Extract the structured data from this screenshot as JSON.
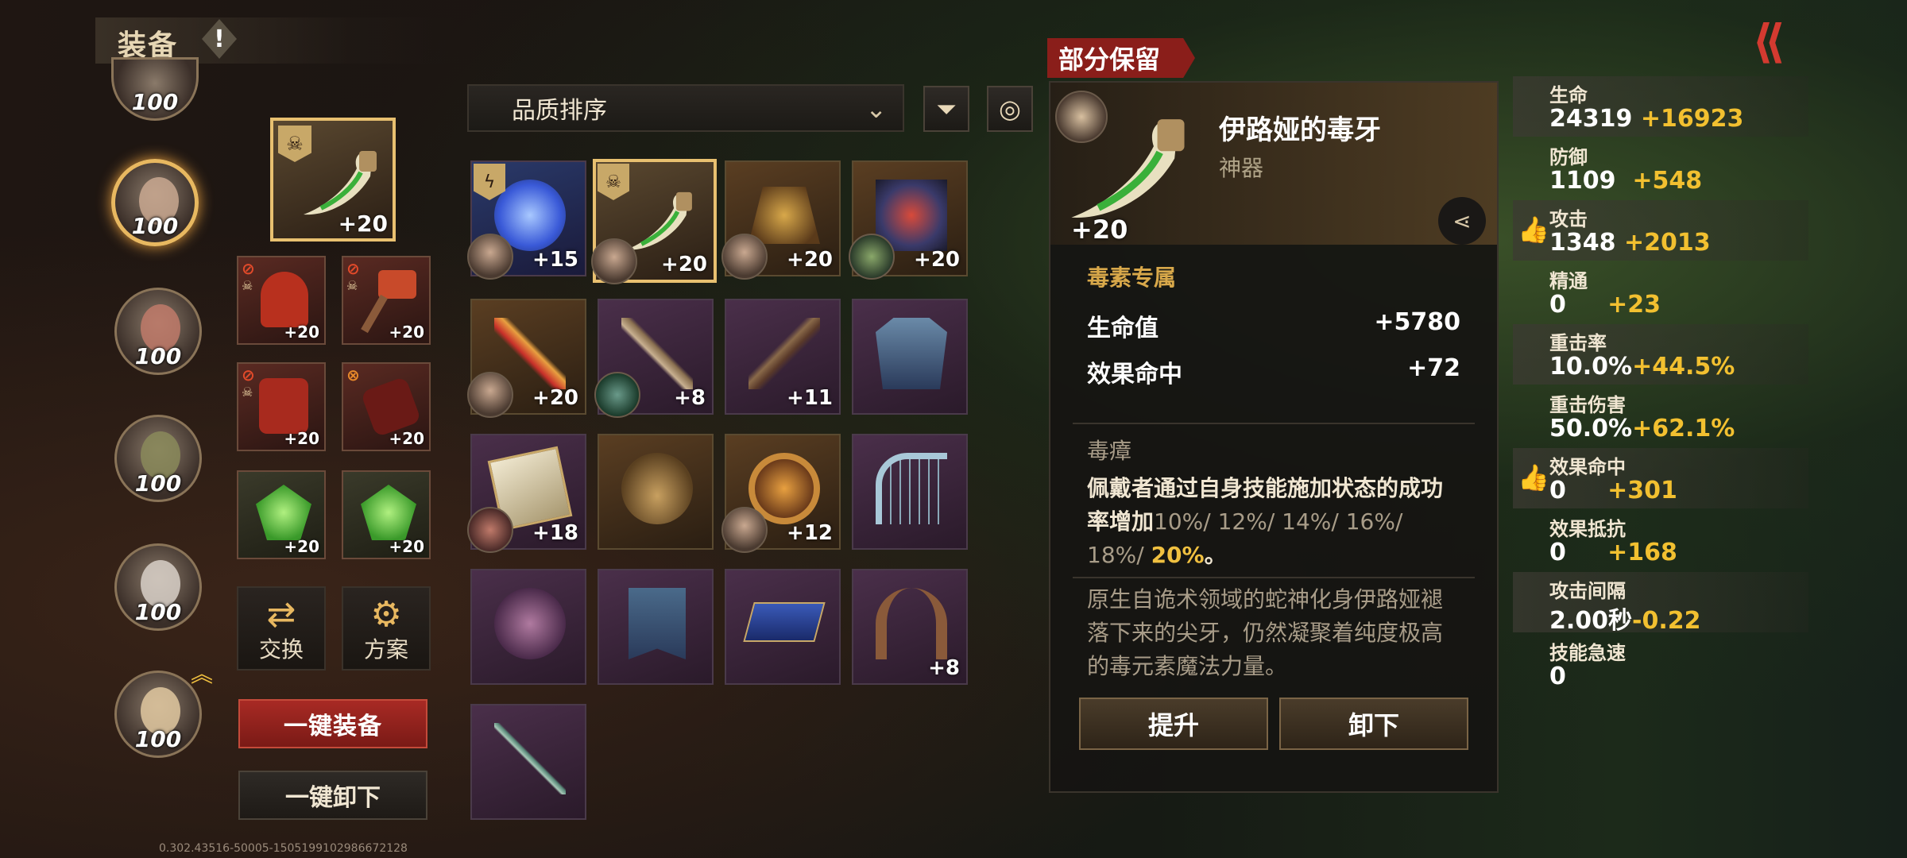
{
  "header": {
    "title": "装备",
    "info_icon": "!",
    "back_icon": "⟪"
  },
  "heroes": [
    {
      "level": "100"
    },
    {
      "level": "100",
      "selected": true
    },
    {
      "level": "100"
    },
    {
      "level": "100"
    },
    {
      "level": "100"
    },
    {
      "level": "100"
    }
  ],
  "equipped": {
    "main_plus": "+20",
    "gear": [
      "+20",
      "+20",
      "+20",
      "+20"
    ],
    "gems": [
      "+20",
      "+20"
    ]
  },
  "utility": {
    "swap_label": "交换",
    "plan_label": "方案"
  },
  "actions": {
    "equip_all": "一键装备",
    "unequip_all": "一键卸下"
  },
  "version": "0.302.43516-50005-1505199102986672128",
  "sort": {
    "label": "品质排序"
  },
  "inventory": [
    {
      "plus": "+15",
      "owner": true,
      "kind": "orb"
    },
    {
      "plus": "+20",
      "owner": true,
      "kind": "fang",
      "selected": true
    },
    {
      "plus": "+20",
      "owner": true,
      "kind": "gold"
    },
    {
      "plus": "+20",
      "owner": true,
      "kind": "gold"
    },
    {
      "plus": "+20",
      "owner": true,
      "kind": "gold"
    },
    {
      "plus": "+8",
      "owner": true,
      "kind": "purple"
    },
    {
      "plus": "+11",
      "owner": false,
      "kind": "purple"
    },
    {
      "plus": "",
      "owner": false,
      "kind": "purple"
    },
    {
      "plus": "+18",
      "owner": true,
      "kind": "purple"
    },
    {
      "plus": "",
      "owner": false,
      "kind": "gold"
    },
    {
      "plus": "+12",
      "owner": true,
      "kind": "gold"
    },
    {
      "plus": "",
      "owner": false,
      "kind": "purple"
    },
    {
      "plus": "",
      "owner": false,
      "kind": "purple"
    },
    {
      "plus": "",
      "owner": false,
      "kind": "purple"
    },
    {
      "plus": "",
      "owner": false,
      "kind": "purple"
    },
    {
      "plus": "+8",
      "owner": false,
      "kind": "purple"
    },
    {
      "plus": "",
      "owner": false,
      "kind": "purple"
    }
  ],
  "detail": {
    "tag": "部分保留",
    "name": "伊路娅的毒牙",
    "type": "神器",
    "plus": "+20",
    "exclusive_title": "毒素专属",
    "stats": [
      {
        "label": "生命值",
        "value": "+5780"
      },
      {
        "label": "效果命中",
        "value": "+72"
      }
    ],
    "skill_title": "毒瘴",
    "skill_text_1": "佩戴者通过自身技能施加状态的成功率增加",
    "skill_levels": "10%/ 12%/ 14%/ 16%/ 18%/ ",
    "skill_current": "20%",
    "skill_end": "。",
    "lore": "原生自诡术领域的蛇神化身伊路娅褪落下来的尖牙，仍然凝聚着纯度极高的毒元素魔法力量。",
    "upgrade_label": "提升",
    "unequip_label": "卸下"
  },
  "attributes": [
    {
      "label": "生命",
      "base": "24319",
      "bonus": "+16923",
      "recommended": false
    },
    {
      "label": "防御",
      "base": "1109",
      "bonus": "+548",
      "recommended": false
    },
    {
      "label": "攻击",
      "base": "1348",
      "bonus": "+2013",
      "recommended": true
    },
    {
      "label": "精通",
      "base": "0",
      "bonus": "+23",
      "recommended": false
    },
    {
      "label": "重击率",
      "base": "10.0%",
      "bonus": "+44.5%",
      "recommended": false
    },
    {
      "label": "重击伤害",
      "base": "50.0%",
      "bonus": "+62.1%",
      "recommended": false
    },
    {
      "label": "效果命中",
      "base": "0",
      "bonus": "+301",
      "recommended": true
    },
    {
      "label": "效果抵抗",
      "base": "0",
      "bonus": "+168",
      "recommended": false
    },
    {
      "label": "攻击间隔",
      "base": "2.00秒",
      "bonus": "-0.22",
      "recommended": false
    },
    {
      "label": "技能急速",
      "base": "0",
      "bonus": "",
      "recommended": false
    }
  ],
  "colors": {
    "accent_gold": "#f2c030",
    "accent_red": "#a82a24",
    "section_gold": "#d8a84a"
  }
}
